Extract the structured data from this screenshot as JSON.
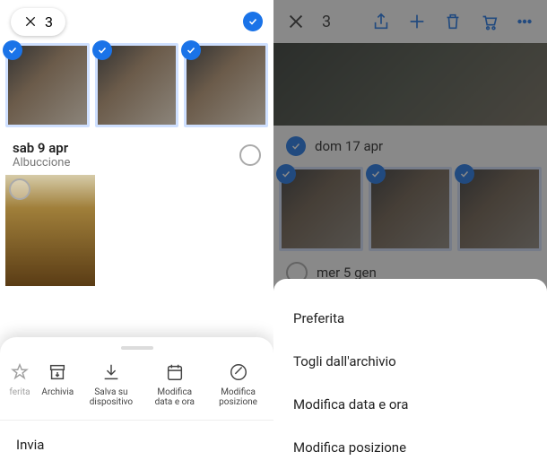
{
  "left": {
    "count": "3",
    "sect1": {
      "date": "sab 9 apr",
      "place": "Albuccione"
    },
    "actions": {
      "fav": "ferita",
      "arch": "Archivia",
      "save": "Salva su dispositivo",
      "date": "Modifica data e ora",
      "loc": "Modifica posizione"
    },
    "send": "Invia"
  },
  "right": {
    "count": "3",
    "sect1": "dom 17 apr",
    "sect2": "mer 5 gen",
    "menu": {
      "fav": "Preferita",
      "unarch": "Togli dall'archivio",
      "date": "Modifica data e ora",
      "loc": "Modifica posizione"
    }
  }
}
